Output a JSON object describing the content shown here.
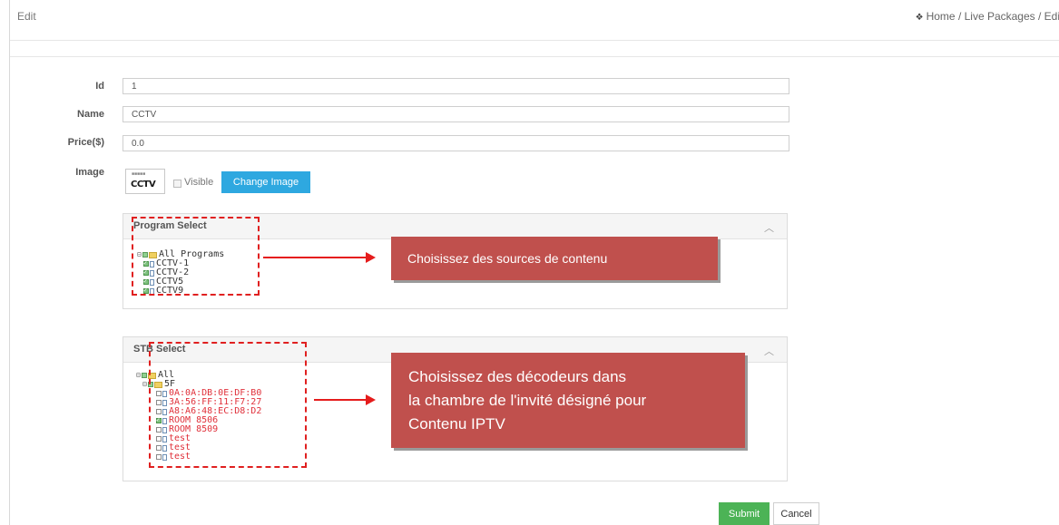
{
  "header": {
    "title": "Edit",
    "breadcrumb": "Home / Live Packages / Edi",
    "home_icon": "home-icon"
  },
  "form": {
    "id_label": "Id",
    "id_value": "1",
    "name_label": "Name",
    "name_value": "CCTV",
    "price_label": "Price($)",
    "price_value": "0.0",
    "image_label": "Image",
    "thumb_caption": "CCTV",
    "visible_label": "Visible",
    "visible_checked": false,
    "change_image_label": "Change Image"
  },
  "program_panel": {
    "title": "Program Select",
    "root": "All Programs",
    "items": [
      {
        "label": "CCTV-1",
        "checked": true
      },
      {
        "label": "CCTV-2",
        "checked": true
      },
      {
        "label": "CCTV5",
        "checked": true
      },
      {
        "label": "CCTV9",
        "checked": true
      }
    ]
  },
  "stb_panel": {
    "title": "STB Select",
    "root": "All",
    "group": "5F",
    "items": [
      {
        "label": "0A:0A:DB:0E:DF:B0",
        "checked": false
      },
      {
        "label": "3A:56:FF:11:F7:27",
        "checked": false
      },
      {
        "label": "A8:A6:48:EC:D8:D2",
        "checked": false
      },
      {
        "label": "ROOM 8506",
        "checked": true
      },
      {
        "label": "ROOM 8509",
        "checked": false
      },
      {
        "label": "test",
        "checked": false
      },
      {
        "label": "test",
        "checked": false
      },
      {
        "label": "test",
        "checked": false
      }
    ]
  },
  "annotations": {
    "callout1": "Choisissez des sources de contenu",
    "callout2_line1": "Choisissez des décodeurs dans",
    "callout2_line2": "la chambre de l'invité désigné pour",
    "callout2_line3": "Contenu IPTV",
    "accent_color": "#c0504d",
    "dash_color": "#e02020"
  },
  "actions": {
    "submit_label": "Submit",
    "cancel_label": "Cancel",
    "submit_color": "#4cb356",
    "change_image_color": "#2ea8e0"
  }
}
